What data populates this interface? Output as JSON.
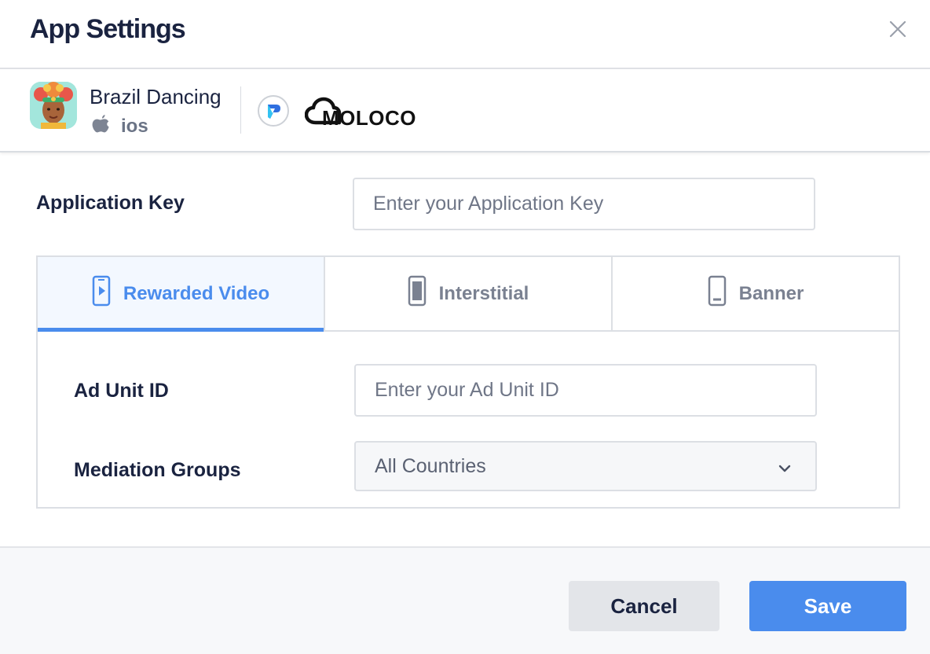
{
  "header": {
    "title": "App Settings",
    "close_icon": "close-icon"
  },
  "app": {
    "name": "Brazil Dancing",
    "platform": "ios",
    "platform_icon": "apple-icon",
    "network_badge_icon": "network-logo-icon",
    "network_logo_text": "MOLOCO"
  },
  "form": {
    "app_key_label": "Application Key",
    "app_key_placeholder": "Enter your Application Key",
    "app_key_value": "",
    "ad_unit_label": "Ad Unit ID",
    "ad_unit_placeholder": "Enter your Ad Unit ID",
    "ad_unit_value": "",
    "mediation_label": "Mediation Groups",
    "mediation_selected": "All Countries"
  },
  "tabs": [
    {
      "label": "Rewarded Video",
      "icon": "video-phone-icon",
      "active": true
    },
    {
      "label": "Interstitial",
      "icon": "phone-fullscreen-icon",
      "active": false
    },
    {
      "label": "Banner",
      "icon": "phone-banner-icon",
      "active": false
    }
  ],
  "footer": {
    "cancel_label": "Cancel",
    "save_label": "Save"
  },
  "colors": {
    "accent": "#4a8ced",
    "title_text": "#1a2340",
    "muted_text": "#7a8191",
    "border": "#dcdfe4"
  }
}
